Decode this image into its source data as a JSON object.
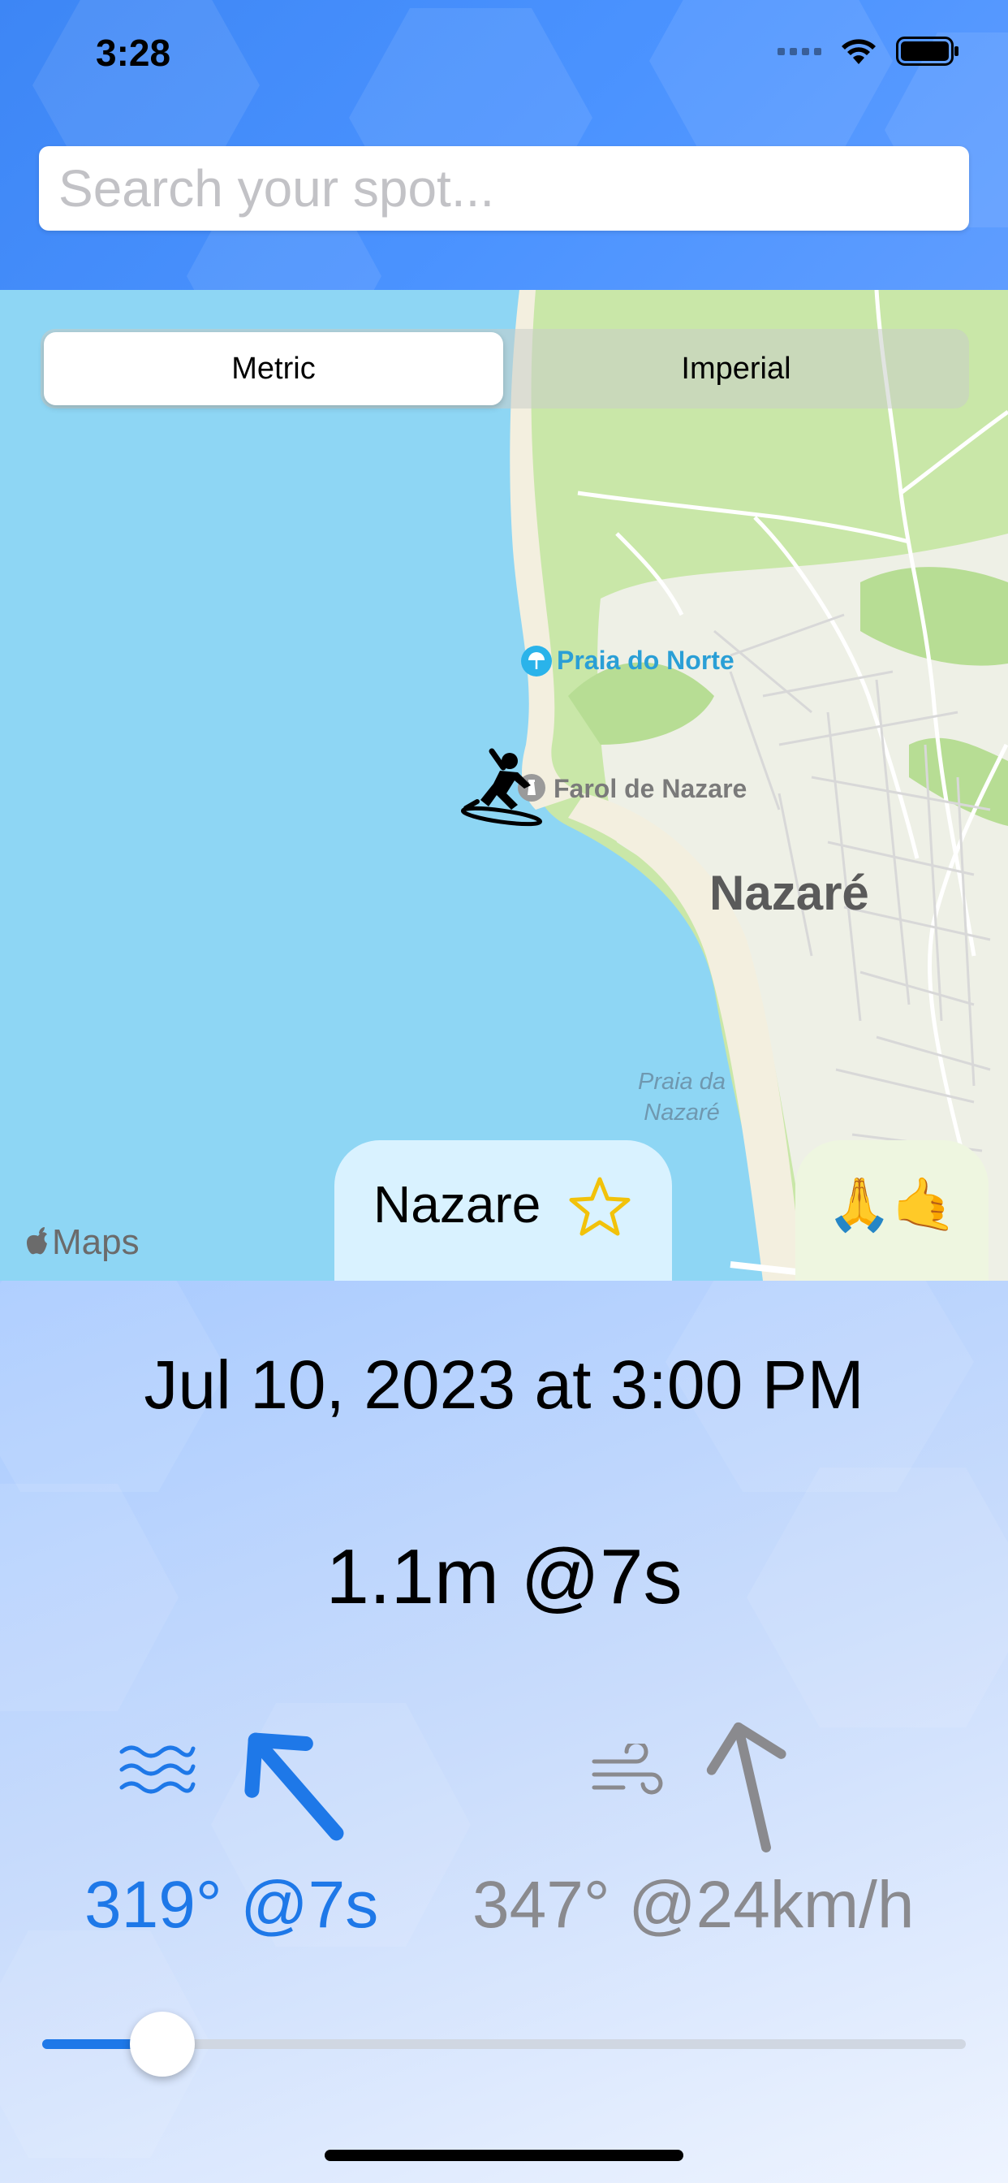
{
  "status_bar": {
    "time": "3:28"
  },
  "search": {
    "placeholder": "Search your spot..."
  },
  "units": {
    "options": [
      "Metric",
      "Imperial"
    ],
    "selected": "Metric"
  },
  "map": {
    "labels": {
      "poi_beach": "Praia do Norte",
      "poi_lighthouse": "Farol de Nazare",
      "town": "Nazaré",
      "beach_south_line1": "Praia da",
      "beach_south_line2": "Nazaré"
    },
    "attribution": "Maps",
    "surfer_icon": "surfer-icon"
  },
  "spot_card": {
    "name": "Nazare",
    "favorite_icon": "star-outline-icon",
    "emoji": "🙏🤙"
  },
  "forecast": {
    "datetime": "Jul 10, 2023 at 3:00 PM",
    "summary": "1.1m @7s",
    "swell": {
      "icon": "waves-icon",
      "direction_deg": 319,
      "text": "319° @7s",
      "color": "#1e78e8"
    },
    "wind": {
      "icon": "wind-icon",
      "direction_deg": 347,
      "text": "347° @24km/h",
      "color": "#8a8a8e"
    },
    "time_slider_fraction": 0.13
  }
}
